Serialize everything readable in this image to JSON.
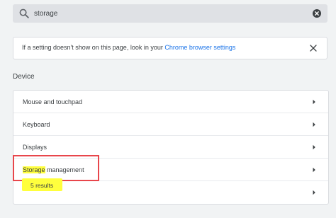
{
  "search": {
    "value": "storage",
    "icon": "search-icon",
    "clear_icon": "clear-search-icon"
  },
  "banner": {
    "text": "If a setting doesn't show on this page, look in your ",
    "link_text": "Chrome browser settings",
    "dismiss_icon": "close-icon",
    "link_color": "#1a73e8"
  },
  "section": {
    "title": "Device"
  },
  "device_items": [
    {
      "label": "Mouse and touchpad",
      "icon": "chevron-right-icon"
    },
    {
      "label": "Keyboard",
      "icon": "chevron-right-icon"
    },
    {
      "label": "Displays",
      "icon": "chevron-right-icon"
    },
    {
      "label_highlight": "Storage",
      "label_rest": " management",
      "icon": "chevron-right-icon"
    },
    {
      "label": "",
      "icon": "chevron-right-icon"
    }
  ],
  "results_badge": {
    "text": "5 results",
    "color": "#ffff3d"
  },
  "colors": {
    "background": "#f1f3f4",
    "search_bg": "#dfe1e5",
    "highlight_box": "#e8464b",
    "match_highlight": "#ffff3d"
  }
}
